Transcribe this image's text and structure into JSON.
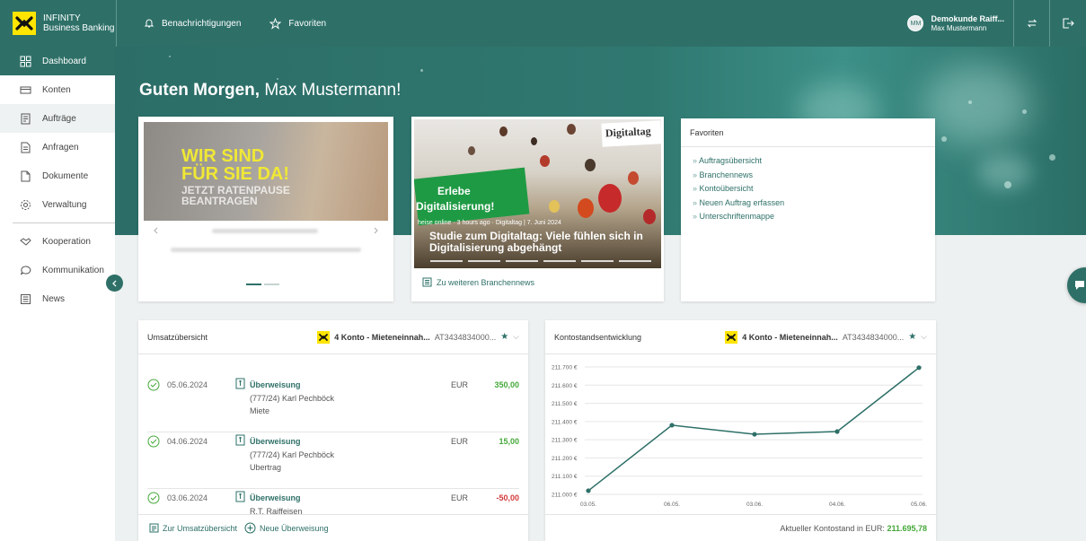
{
  "brand": {
    "line1": "INFINITY",
    "line2": "Business Banking"
  },
  "topnav": {
    "notifications": "Benachrichtigungen",
    "favorites": "Favoriten"
  },
  "user": {
    "initials": "MM",
    "company": "Demokunde Raiff...",
    "name": "Max Mustermann"
  },
  "sidebar": {
    "items": [
      {
        "label": "Dashboard",
        "icon": "grid-icon"
      },
      {
        "label": "Konten",
        "icon": "card-icon"
      },
      {
        "label": "Aufträge",
        "icon": "orders-icon"
      },
      {
        "label": "Anfragen",
        "icon": "request-icon"
      },
      {
        "label": "Dokumente",
        "icon": "document-icon"
      },
      {
        "label": "Verwaltung",
        "icon": "gear-icon"
      },
      {
        "label": "Kooperation",
        "icon": "handshake-icon"
      },
      {
        "label": "Kommunikation",
        "icon": "chat-icon"
      },
      {
        "label": "News",
        "icon": "news-icon"
      }
    ]
  },
  "greeting": {
    "prefix": "Guten Morgen,",
    "name": "Max Mustermann!"
  },
  "promo": {
    "line1": "WIR SIND",
    "line2": "FÜR SIE DA!",
    "line3": "JETZT RATENPAUSE",
    "line4": "BEANTRAGEN"
  },
  "news": {
    "logo": "Digitaltag",
    "banner_line1": "Erlebe",
    "banner_line2": "Digitalisierung!",
    "source": "heise online",
    "age": "3 hours ago",
    "date_line": "Digitaltag | 7. Juni 2024",
    "title": "Studie zum Digitaltag: Viele fühlen sich in Digitalisierung abgehängt",
    "link": "Zu weiteren Branchennews"
  },
  "favorites": {
    "title": "Favoriten",
    "items": [
      "Auftragsübersicht",
      "Branchennews",
      "Kontoübersicht",
      "Neuen Auftrag erfassen",
      "Unterschriftenmappe"
    ]
  },
  "transactions": {
    "title": "Umsatzübersicht",
    "account": "4 Konto - Mieteneinnah...",
    "iban": "AT3434834000...",
    "rows": [
      {
        "date": "05.06.2024",
        "type": "Überweisung",
        "line1": "(777/24) Karl Pechböck",
        "line2": "Miete",
        "currency": "EUR",
        "amount": "350,00"
      },
      {
        "date": "04.06.2024",
        "type": "Überweisung",
        "line1": "(777/24) Karl Pechböck",
        "line2": "Ubertrag",
        "currency": "EUR",
        "amount": "15,00"
      },
      {
        "date": "03.06.2024",
        "type": "Überweisung",
        "line1": "R.T. Raiffeisen",
        "line2": "",
        "currency": "EUR",
        "amount": "-50,00"
      }
    ],
    "footer_overview": "Zur Umsatzübersicht",
    "footer_new": "Neue Überweisung"
  },
  "balance": {
    "title": "Kontostandsentwicklung",
    "account": "4 Konto - Mieteneinnah...",
    "iban": "AT3434834000...",
    "footer_label": "Aktueller Kontostand in EUR:",
    "footer_value": "211.695,78"
  },
  "colors": {
    "primary": "#2e7068",
    "positive": "#45a83a",
    "negative": "#d23a3a",
    "brand_yellow": "#ffe500"
  },
  "chart_data": {
    "type": "line",
    "x": [
      "03.05.",
      "06.05.",
      "03.06.",
      "04.06.",
      "05.06."
    ],
    "values": [
      211020,
      211380,
      211330,
      211345,
      211696
    ],
    "yticks": [
      "211.000 €",
      "211.100 €",
      "211.200 €",
      "211.300 €",
      "211.400 €",
      "211.500 €",
      "211.600 €",
      "211.700 €"
    ],
    "ylim": [
      211000,
      211700
    ],
    "grid": true
  }
}
